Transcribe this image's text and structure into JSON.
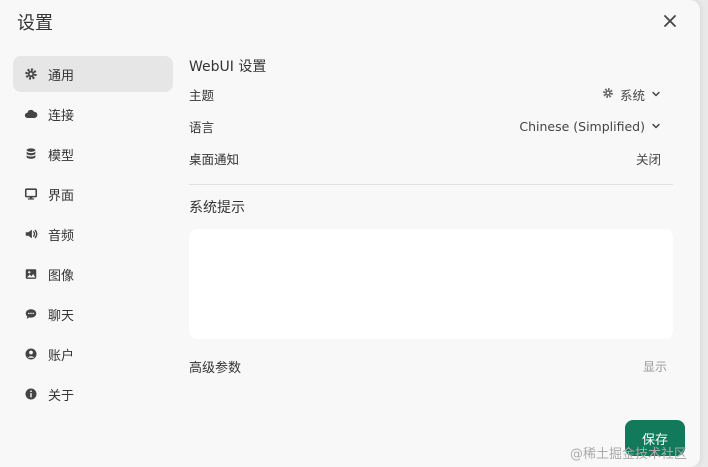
{
  "dialog": {
    "title": "设置",
    "save_label": "保存"
  },
  "sidebar": {
    "items": [
      {
        "label": "通用",
        "icon": "gear-icon",
        "active": true
      },
      {
        "label": "连接",
        "icon": "cloud-icon"
      },
      {
        "label": "模型",
        "icon": "database-icon"
      },
      {
        "label": "界面",
        "icon": "monitor-icon"
      },
      {
        "label": "音频",
        "icon": "speaker-icon"
      },
      {
        "label": "图像",
        "icon": "image-icon"
      },
      {
        "label": "聊天",
        "icon": "chat-bubble-icon"
      },
      {
        "label": "账户",
        "icon": "user-circle-icon"
      },
      {
        "label": "关于",
        "icon": "info-icon"
      }
    ]
  },
  "general": {
    "section_title": "WebUI 设置",
    "theme": {
      "label": "主题",
      "value": "系统"
    },
    "language": {
      "label": "语言",
      "value": "Chinese (Simplified)"
    },
    "notifications": {
      "label": "桌面通知",
      "value": "关闭"
    },
    "system_prompt": {
      "label": "系统提示",
      "value": ""
    },
    "advanced": {
      "label": "高级参数",
      "toggle": "显示"
    }
  },
  "watermark": "@稀土掘金技术社区",
  "colors": {
    "accent": "#127a5a",
    "active_bg": "#e6e6e6",
    "modal_bg": "#f8f8f8"
  }
}
